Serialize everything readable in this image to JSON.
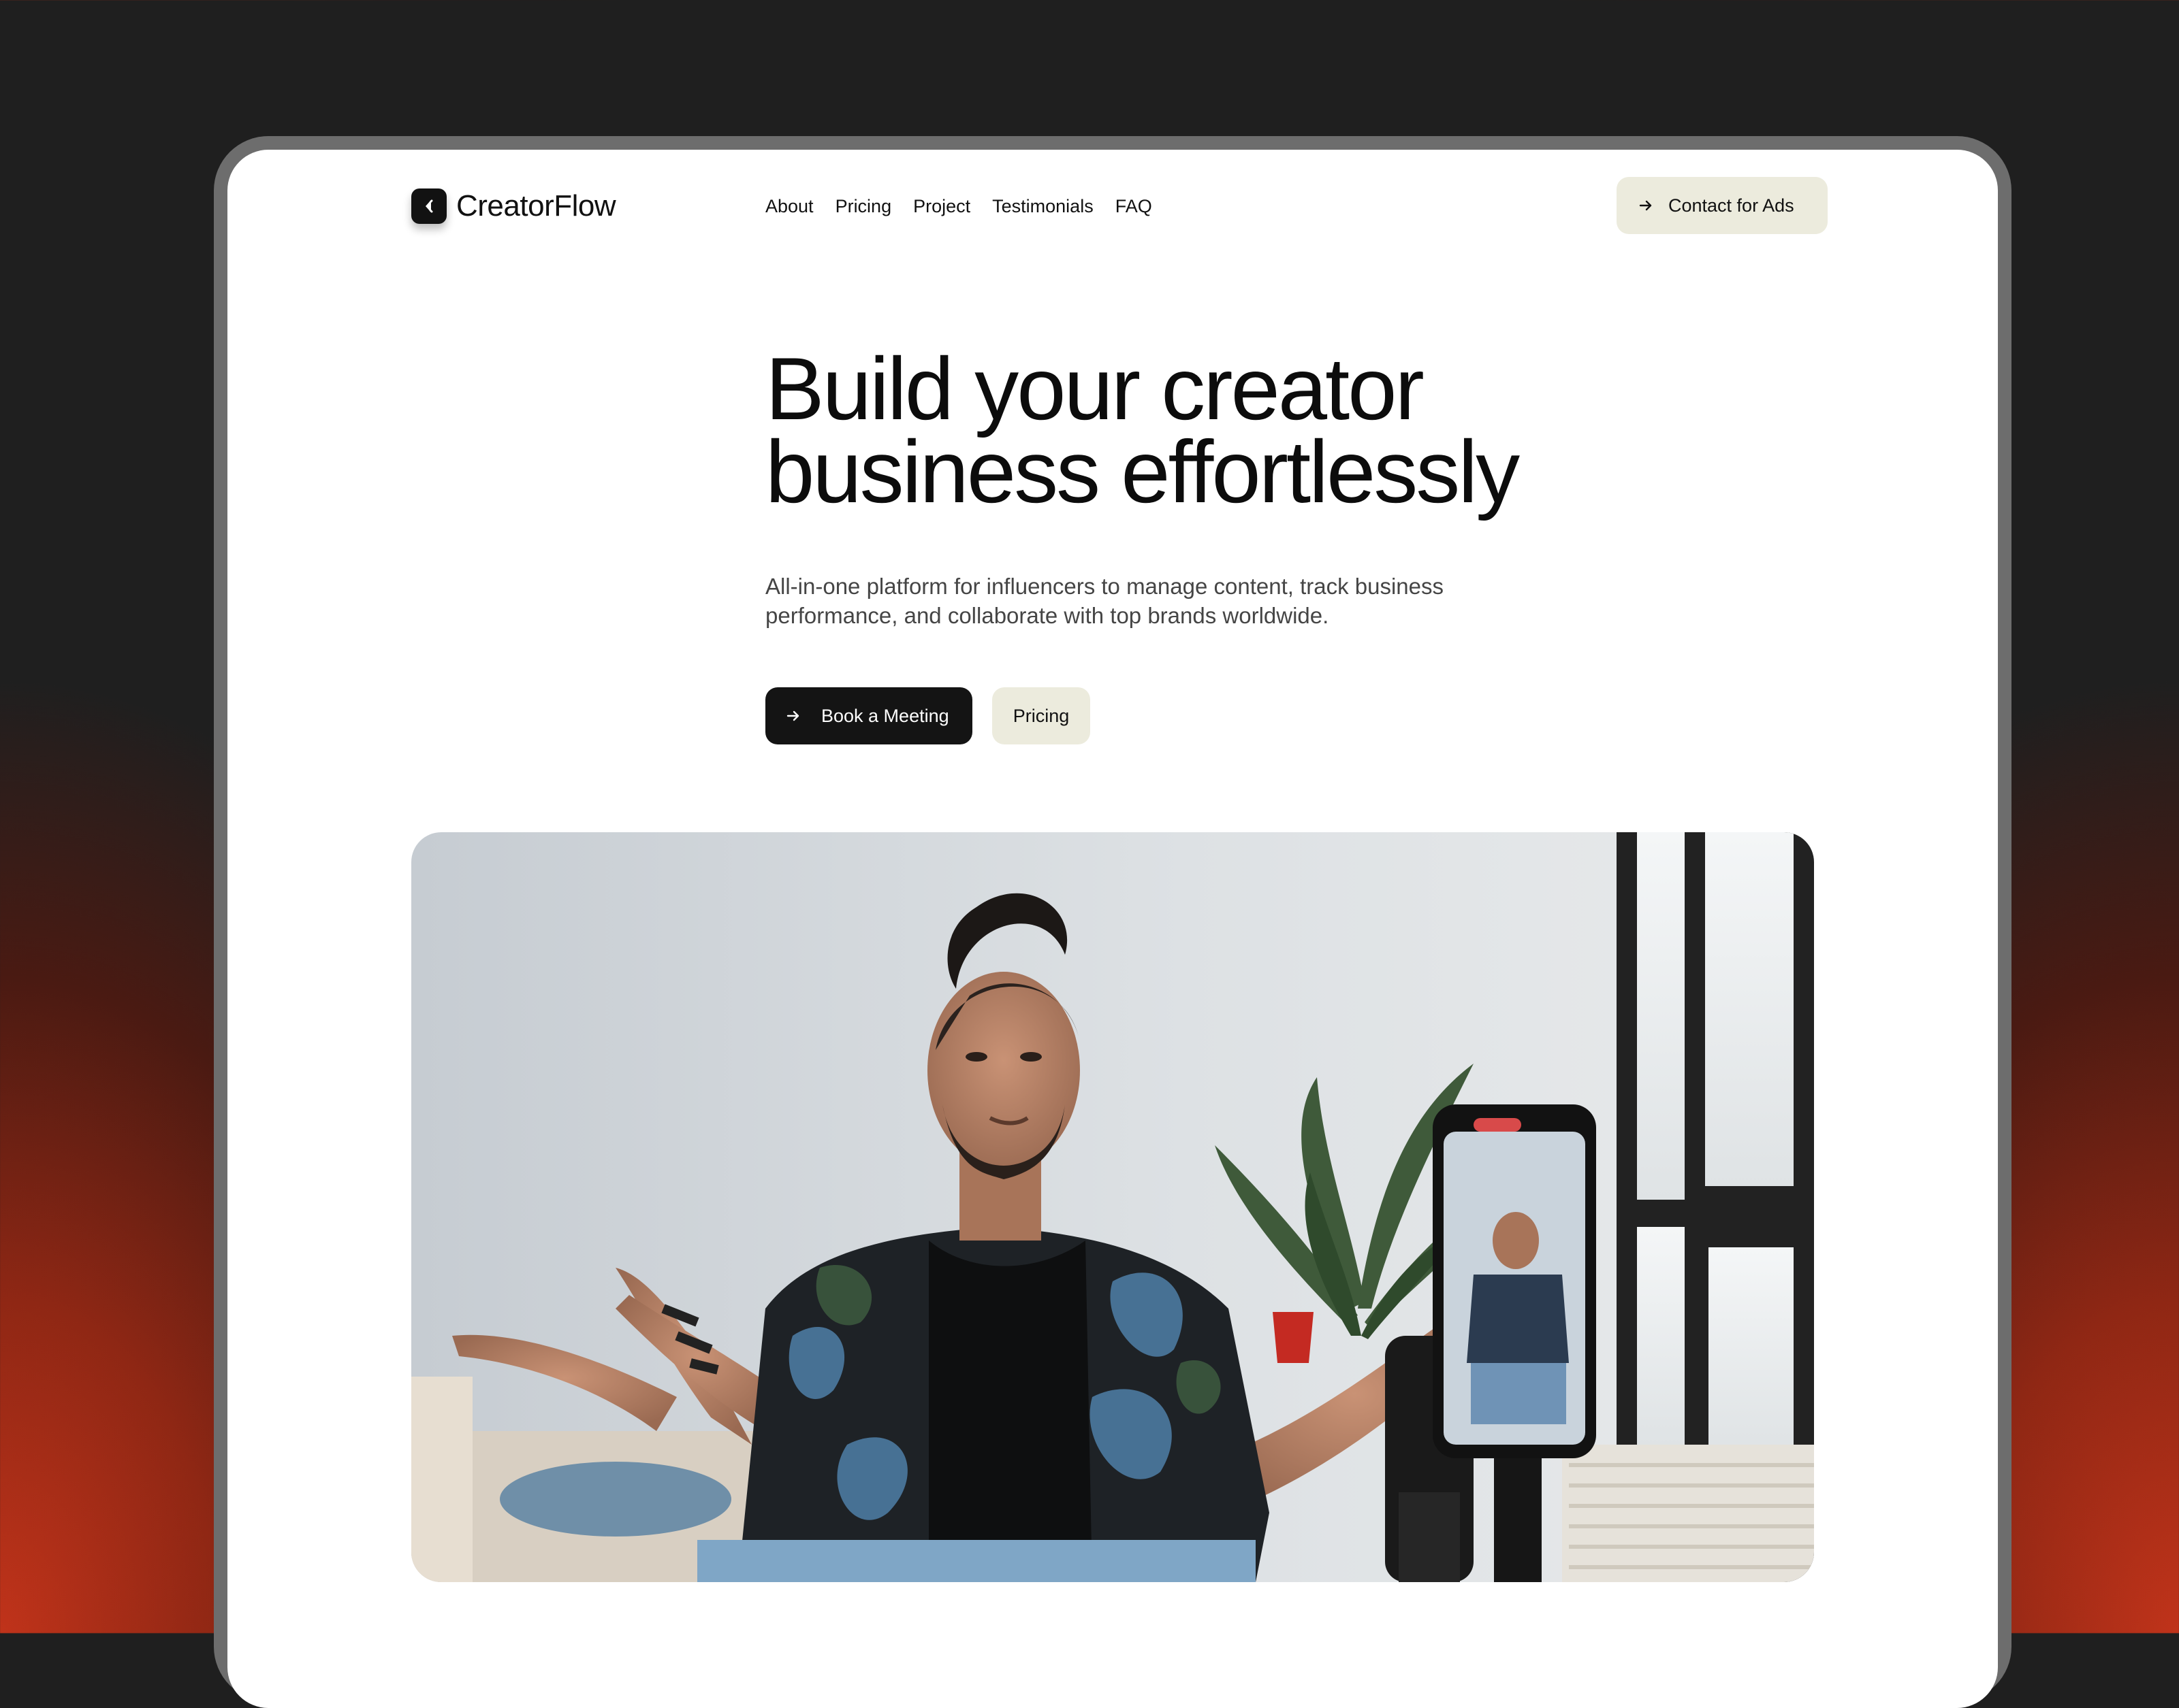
{
  "brand": {
    "name": "CreatorFlow",
    "logo_icon": "chevron-left-icon"
  },
  "nav": {
    "items": [
      "About",
      "Pricing",
      "Project",
      "Testimonials",
      "FAQ"
    ]
  },
  "header_cta": {
    "label": "Contact for Ads",
    "icon": "arrow-right-icon"
  },
  "hero": {
    "title_line1": "Build your creator",
    "title_line2": "business effortlessly",
    "subtitle": "All-in-one platform for influencers to manage content, track business performance, and collaborate with top brands worldwide.",
    "primary_cta": "Book a Meeting",
    "secondary_cta": "Pricing"
  },
  "colors": {
    "accent_cream": "#ecebdd",
    "dark": "#141414",
    "background_red": "#c0331a"
  }
}
